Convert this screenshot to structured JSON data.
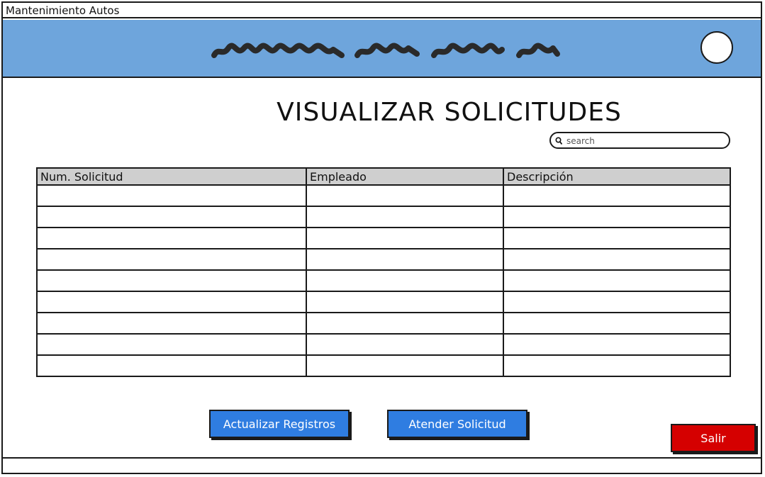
{
  "window": {
    "title": "Mantenimiento Autos"
  },
  "header": {
    "banner_color": "#6ea5dc",
    "logo_placeholder": "circle"
  },
  "main": {
    "title": "VISUALIZAR SOLICITUDES",
    "search": {
      "placeholder": "search",
      "value": "",
      "icon": "search-icon"
    },
    "table": {
      "columns": [
        "Num. Solicitud",
        "Empleado",
        "Descripción"
      ],
      "rows": [
        [
          "",
          "",
          ""
        ],
        [
          "",
          "",
          ""
        ],
        [
          "",
          "",
          ""
        ],
        [
          "",
          "",
          ""
        ],
        [
          "",
          "",
          ""
        ],
        [
          "",
          "",
          ""
        ],
        [
          "",
          "",
          ""
        ],
        [
          "",
          "",
          ""
        ],
        [
          "",
          "",
          ""
        ]
      ]
    }
  },
  "actions": {
    "refresh_label": "Actualizar Registros",
    "attend_label": "Atender Solicitud",
    "exit_label": "Salir"
  },
  "colors": {
    "primary_button": "#2f7de1",
    "danger_button": "#d50000",
    "table_header": "#cfcfcf"
  }
}
